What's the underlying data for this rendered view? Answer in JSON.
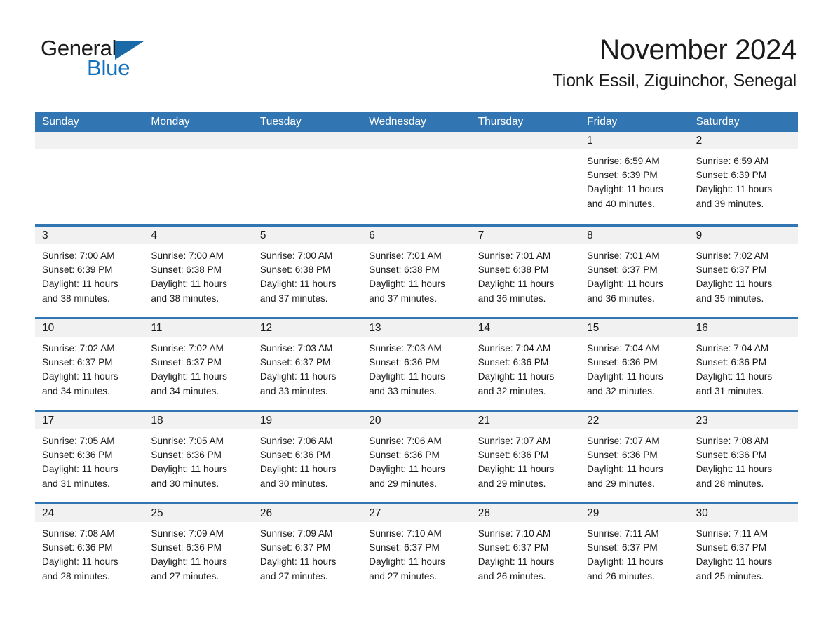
{
  "logo": {
    "word1": "General",
    "word2": "Blue",
    "triangle_icon": "blue-triangle-icon",
    "color_black": "#1a1a1a",
    "color_blue": "#1270bd"
  },
  "header": {
    "month_title": "November 2024",
    "location": "Tionk Essil, Ziguinchor, Senegal"
  },
  "theme": {
    "header_blue": "#3275b3",
    "day_band_gray": "#f1f1f1",
    "text_black": "#1a1a1a"
  },
  "weekdays": [
    "Sunday",
    "Monday",
    "Tuesday",
    "Wednesday",
    "Thursday",
    "Friday",
    "Saturday"
  ],
  "weeks": [
    [
      {
        "day": "",
        "sunrise": "",
        "sunset": "",
        "daylight1": "",
        "daylight2": ""
      },
      {
        "day": "",
        "sunrise": "",
        "sunset": "",
        "daylight1": "",
        "daylight2": ""
      },
      {
        "day": "",
        "sunrise": "",
        "sunset": "",
        "daylight1": "",
        "daylight2": ""
      },
      {
        "day": "",
        "sunrise": "",
        "sunset": "",
        "daylight1": "",
        "daylight2": ""
      },
      {
        "day": "",
        "sunrise": "",
        "sunset": "",
        "daylight1": "",
        "daylight2": ""
      },
      {
        "day": "1",
        "sunrise": "Sunrise: 6:59 AM",
        "sunset": "Sunset: 6:39 PM",
        "daylight1": "Daylight: 11 hours",
        "daylight2": "and 40 minutes."
      },
      {
        "day": "2",
        "sunrise": "Sunrise: 6:59 AM",
        "sunset": "Sunset: 6:39 PM",
        "daylight1": "Daylight: 11 hours",
        "daylight2": "and 39 minutes."
      }
    ],
    [
      {
        "day": "3",
        "sunrise": "Sunrise: 7:00 AM",
        "sunset": "Sunset: 6:39 PM",
        "daylight1": "Daylight: 11 hours",
        "daylight2": "and 38 minutes."
      },
      {
        "day": "4",
        "sunrise": "Sunrise: 7:00 AM",
        "sunset": "Sunset: 6:38 PM",
        "daylight1": "Daylight: 11 hours",
        "daylight2": "and 38 minutes."
      },
      {
        "day": "5",
        "sunrise": "Sunrise: 7:00 AM",
        "sunset": "Sunset: 6:38 PM",
        "daylight1": "Daylight: 11 hours",
        "daylight2": "and 37 minutes."
      },
      {
        "day": "6",
        "sunrise": "Sunrise: 7:01 AM",
        "sunset": "Sunset: 6:38 PM",
        "daylight1": "Daylight: 11 hours",
        "daylight2": "and 37 minutes."
      },
      {
        "day": "7",
        "sunrise": "Sunrise: 7:01 AM",
        "sunset": "Sunset: 6:38 PM",
        "daylight1": "Daylight: 11 hours",
        "daylight2": "and 36 minutes."
      },
      {
        "day": "8",
        "sunrise": "Sunrise: 7:01 AM",
        "sunset": "Sunset: 6:37 PM",
        "daylight1": "Daylight: 11 hours",
        "daylight2": "and 36 minutes."
      },
      {
        "day": "9",
        "sunrise": "Sunrise: 7:02 AM",
        "sunset": "Sunset: 6:37 PM",
        "daylight1": "Daylight: 11 hours",
        "daylight2": "and 35 minutes."
      }
    ],
    [
      {
        "day": "10",
        "sunrise": "Sunrise: 7:02 AM",
        "sunset": "Sunset: 6:37 PM",
        "daylight1": "Daylight: 11 hours",
        "daylight2": "and 34 minutes."
      },
      {
        "day": "11",
        "sunrise": "Sunrise: 7:02 AM",
        "sunset": "Sunset: 6:37 PM",
        "daylight1": "Daylight: 11 hours",
        "daylight2": "and 34 minutes."
      },
      {
        "day": "12",
        "sunrise": "Sunrise: 7:03 AM",
        "sunset": "Sunset: 6:37 PM",
        "daylight1": "Daylight: 11 hours",
        "daylight2": "and 33 minutes."
      },
      {
        "day": "13",
        "sunrise": "Sunrise: 7:03 AM",
        "sunset": "Sunset: 6:36 PM",
        "daylight1": "Daylight: 11 hours",
        "daylight2": "and 33 minutes."
      },
      {
        "day": "14",
        "sunrise": "Sunrise: 7:04 AM",
        "sunset": "Sunset: 6:36 PM",
        "daylight1": "Daylight: 11 hours",
        "daylight2": "and 32 minutes."
      },
      {
        "day": "15",
        "sunrise": "Sunrise: 7:04 AM",
        "sunset": "Sunset: 6:36 PM",
        "daylight1": "Daylight: 11 hours",
        "daylight2": "and 32 minutes."
      },
      {
        "day": "16",
        "sunrise": "Sunrise: 7:04 AM",
        "sunset": "Sunset: 6:36 PM",
        "daylight1": "Daylight: 11 hours",
        "daylight2": "and 31 minutes."
      }
    ],
    [
      {
        "day": "17",
        "sunrise": "Sunrise: 7:05 AM",
        "sunset": "Sunset: 6:36 PM",
        "daylight1": "Daylight: 11 hours",
        "daylight2": "and 31 minutes."
      },
      {
        "day": "18",
        "sunrise": "Sunrise: 7:05 AM",
        "sunset": "Sunset: 6:36 PM",
        "daylight1": "Daylight: 11 hours",
        "daylight2": "and 30 minutes."
      },
      {
        "day": "19",
        "sunrise": "Sunrise: 7:06 AM",
        "sunset": "Sunset: 6:36 PM",
        "daylight1": "Daylight: 11 hours",
        "daylight2": "and 30 minutes."
      },
      {
        "day": "20",
        "sunrise": "Sunrise: 7:06 AM",
        "sunset": "Sunset: 6:36 PM",
        "daylight1": "Daylight: 11 hours",
        "daylight2": "and 29 minutes."
      },
      {
        "day": "21",
        "sunrise": "Sunrise: 7:07 AM",
        "sunset": "Sunset: 6:36 PM",
        "daylight1": "Daylight: 11 hours",
        "daylight2": "and 29 minutes."
      },
      {
        "day": "22",
        "sunrise": "Sunrise: 7:07 AM",
        "sunset": "Sunset: 6:36 PM",
        "daylight1": "Daylight: 11 hours",
        "daylight2": "and 29 minutes."
      },
      {
        "day": "23",
        "sunrise": "Sunrise: 7:08 AM",
        "sunset": "Sunset: 6:36 PM",
        "daylight1": "Daylight: 11 hours",
        "daylight2": "and 28 minutes."
      }
    ],
    [
      {
        "day": "24",
        "sunrise": "Sunrise: 7:08 AM",
        "sunset": "Sunset: 6:36 PM",
        "daylight1": "Daylight: 11 hours",
        "daylight2": "and 28 minutes."
      },
      {
        "day": "25",
        "sunrise": "Sunrise: 7:09 AM",
        "sunset": "Sunset: 6:36 PM",
        "daylight1": "Daylight: 11 hours",
        "daylight2": "and 27 minutes."
      },
      {
        "day": "26",
        "sunrise": "Sunrise: 7:09 AM",
        "sunset": "Sunset: 6:37 PM",
        "daylight1": "Daylight: 11 hours",
        "daylight2": "and 27 minutes."
      },
      {
        "day": "27",
        "sunrise": "Sunrise: 7:10 AM",
        "sunset": "Sunset: 6:37 PM",
        "daylight1": "Daylight: 11 hours",
        "daylight2": "and 27 minutes."
      },
      {
        "day": "28",
        "sunrise": "Sunrise: 7:10 AM",
        "sunset": "Sunset: 6:37 PM",
        "daylight1": "Daylight: 11 hours",
        "daylight2": "and 26 minutes."
      },
      {
        "day": "29",
        "sunrise": "Sunrise: 7:11 AM",
        "sunset": "Sunset: 6:37 PM",
        "daylight1": "Daylight: 11 hours",
        "daylight2": "and 26 minutes."
      },
      {
        "day": "30",
        "sunrise": "Sunrise: 7:11 AM",
        "sunset": "Sunset: 6:37 PM",
        "daylight1": "Daylight: 11 hours",
        "daylight2": "and 25 minutes."
      }
    ]
  ]
}
